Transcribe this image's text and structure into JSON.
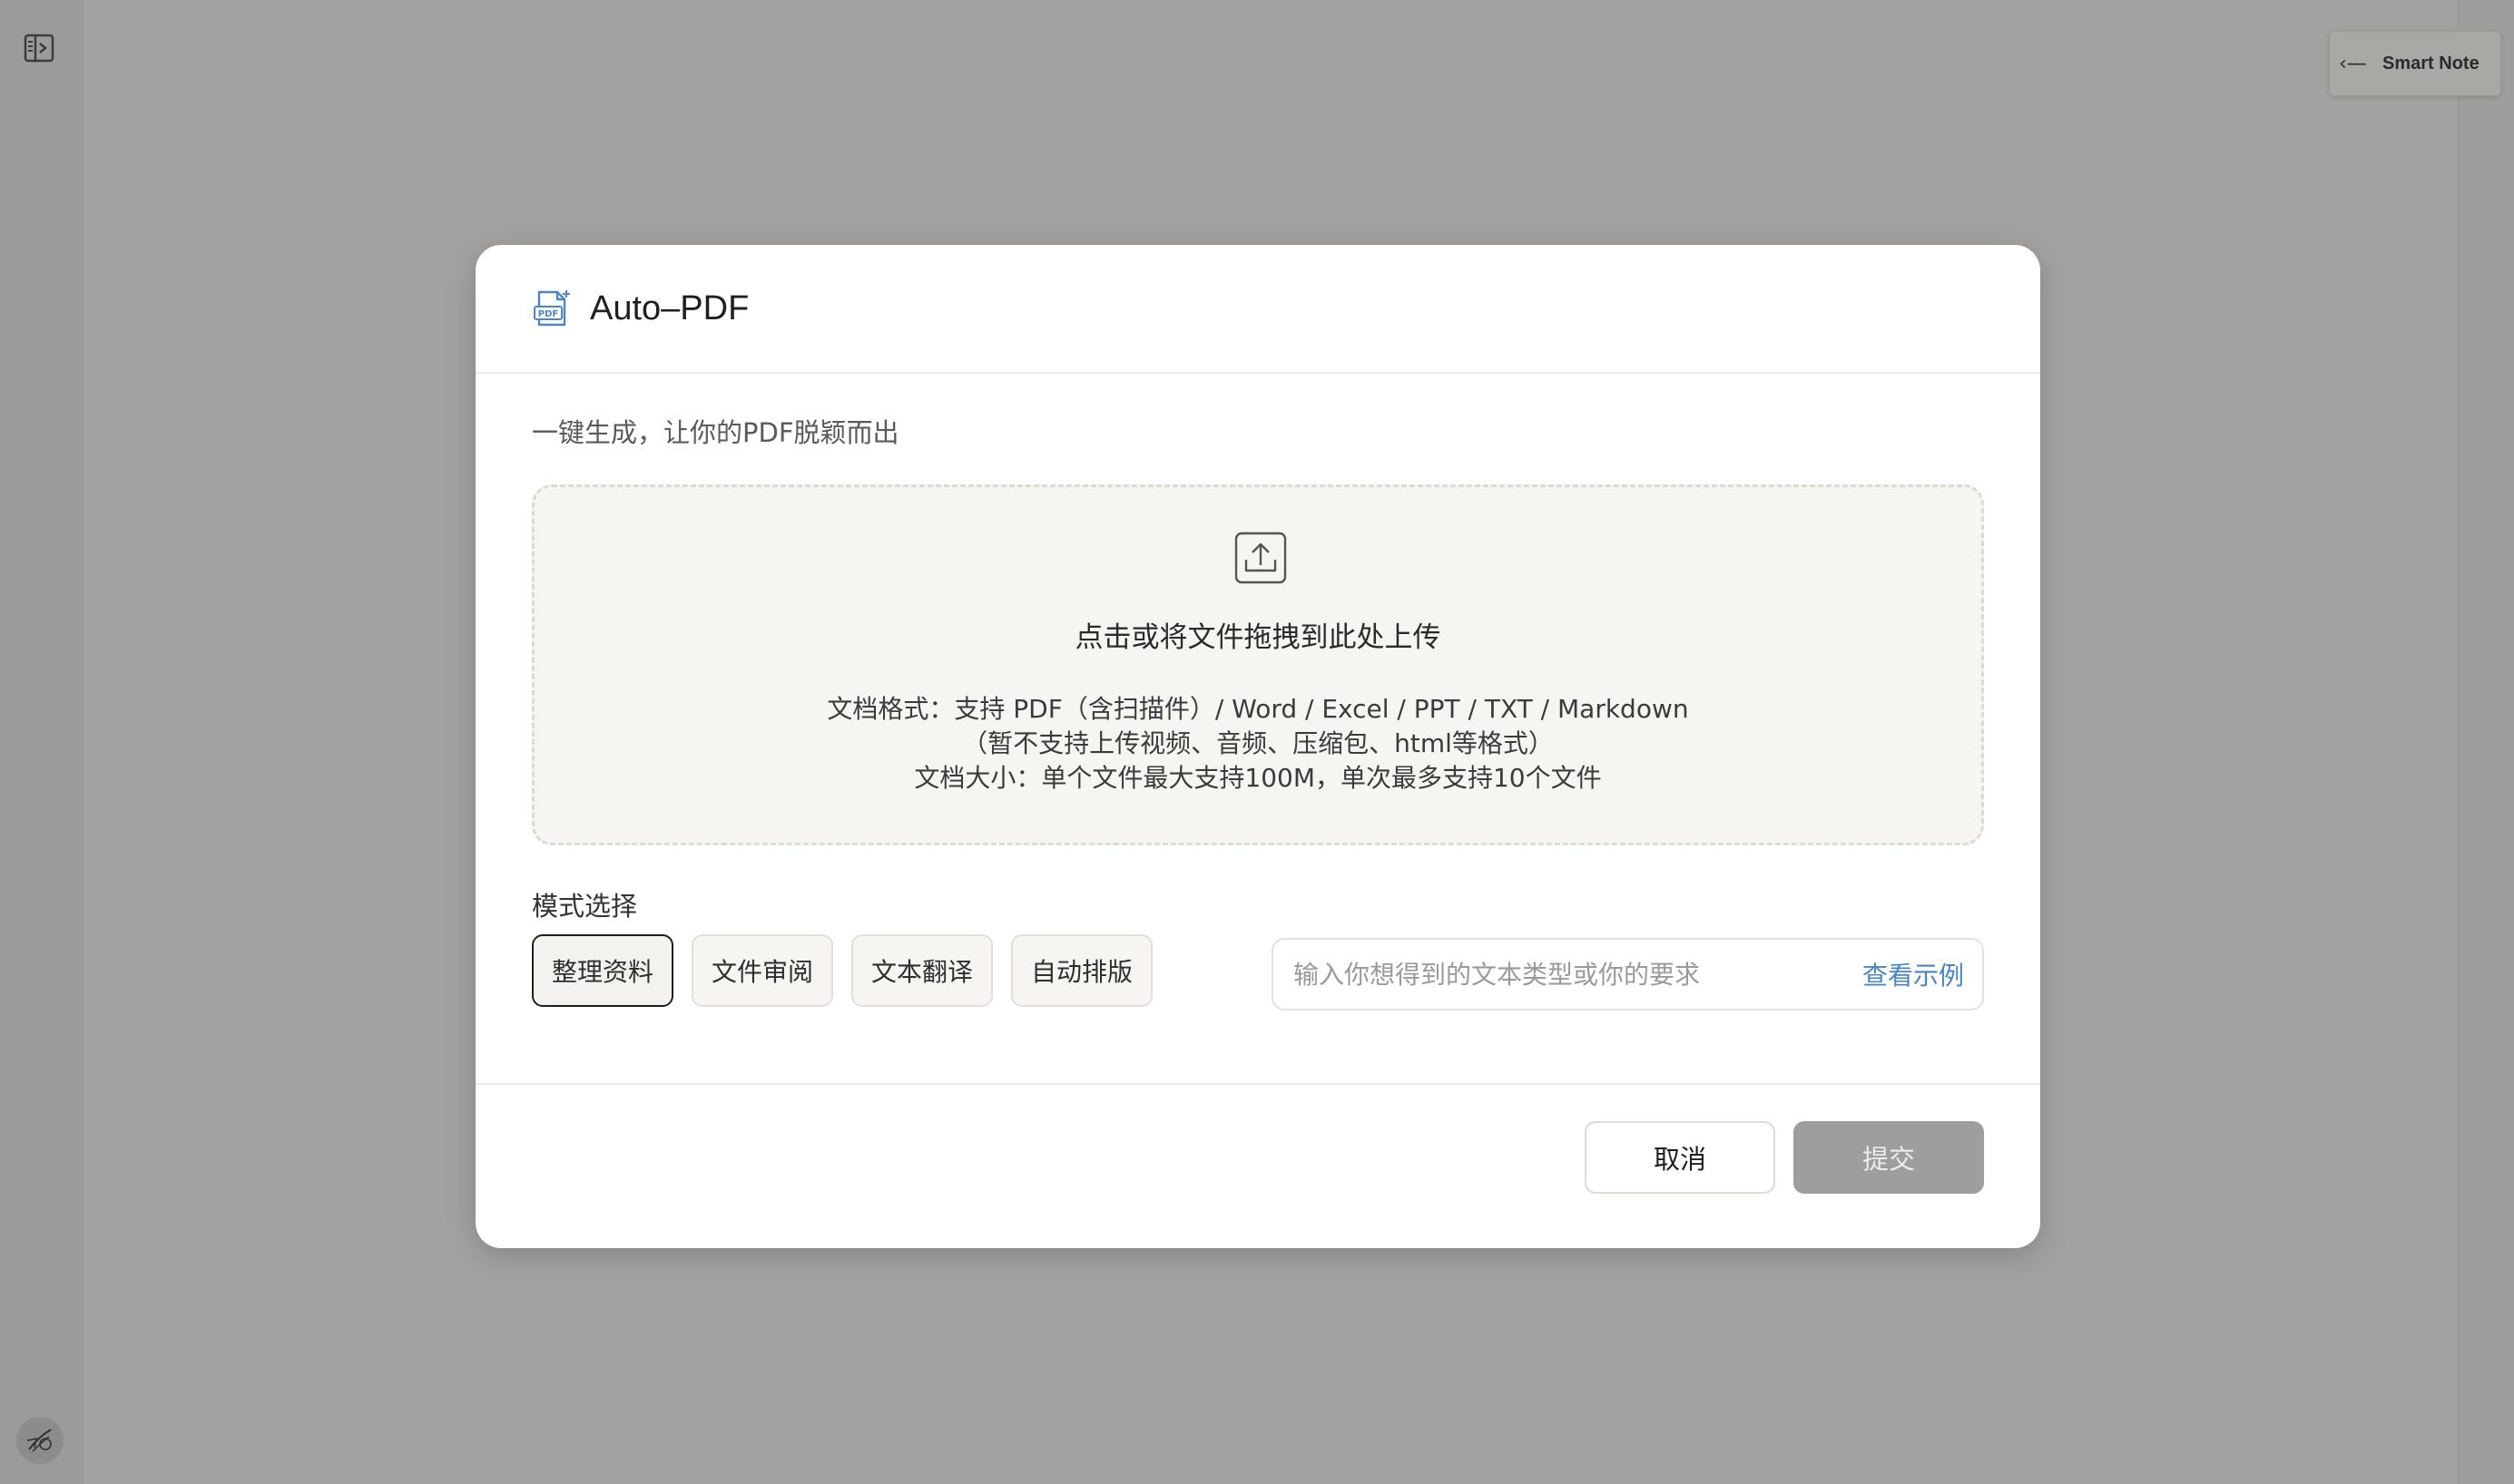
{
  "background": {
    "smart_note_tab": {
      "arrow": "‹—",
      "label": "Smart Note"
    }
  },
  "modal": {
    "title": "Auto–PDF",
    "subtitle": "一键生成，让你的PDF脱颖而出",
    "upload": {
      "title": "点击或将文件拖拽到此处上传",
      "hint_formats": "文档格式：支持 PDF（含扫描件）/ Word / Excel / PPT / TXT / Markdown",
      "hint_unsupported": "（暂不支持上传视频、音频、压缩包、html等格式）",
      "hint_size": "文档大小：单个文件最大支持100M，单次最多支持10个文件"
    },
    "mode": {
      "label": "模式选择",
      "options": [
        "整理资料",
        "文件审阅",
        "文本翻译",
        "自动排版"
      ],
      "selected": "整理资料"
    },
    "request_input": {
      "placeholder": "输入你想得到的文本类型或你的要求",
      "value": "",
      "example_link": "查看示例"
    },
    "footer": {
      "cancel_label": "取消",
      "submit_label": "提交"
    }
  },
  "colors": {
    "accent_link": "#4a86c5",
    "pdf_icon": "#4a86c5",
    "submit_disabled": "#9e9e9e",
    "overlay": "#a3a2a0"
  },
  "icons": [
    "sidebar-toggle-icon",
    "avatar-sketch-icon",
    "pdf-file-icon",
    "upload-icon"
  ]
}
